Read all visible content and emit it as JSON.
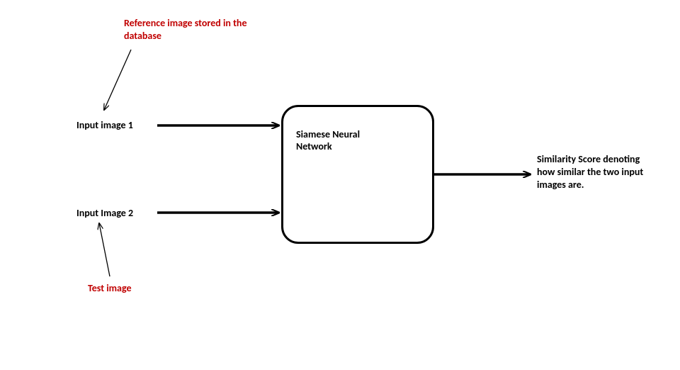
{
  "annotations": {
    "reference_label": "Reference image stored in the database",
    "test_label": "Test image"
  },
  "inputs": {
    "input1_label": "Input image 1",
    "input2_label": "Input Image 2"
  },
  "network": {
    "box_label": "Siamese Neural Network"
  },
  "output": {
    "text": "Similarity Score denoting how similar the two input images are."
  }
}
